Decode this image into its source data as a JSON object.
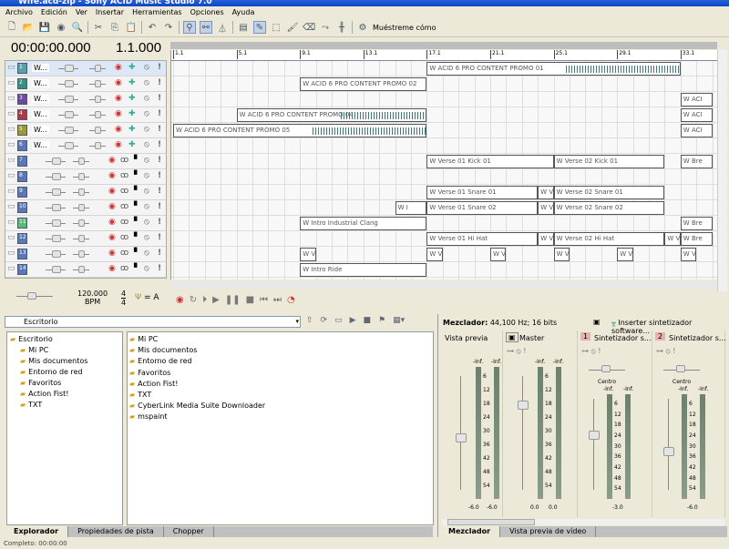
{
  "window": {
    "title": "Wife.acd-zip - Sony ACID Music Studio 7.0"
  },
  "menu": [
    "Archivo",
    "Edición",
    "Ver",
    "Insertar",
    "Herramientas",
    "Opciones",
    "Ayuda"
  ],
  "toolbar": {
    "show_me_label": "Muéstreme cómo",
    "icons": [
      "new-icon",
      "open-icon",
      "save-icon",
      "render-icon",
      "properties-icon",
      "cut-icon",
      "copy-icon",
      "paste-icon",
      "undo-icon",
      "redo-icon",
      "snap-icon",
      "auto-ripple-icon",
      "metronome-icon",
      "properties-window-icon",
      "draw-tool-icon",
      "selection-tool-icon",
      "paint-tool-icon",
      "erase-tool-icon",
      "envelope-tool-icon",
      "split-icon"
    ]
  },
  "transport": {
    "time": "00:00:00.000",
    "measure": "1.1.000",
    "tempo": "120.000",
    "tempo_unit": "BPM",
    "time_sig_top": "4",
    "time_sig_bottom": "4",
    "key": "= A",
    "buttons": [
      "record",
      "loop",
      "play-from-start",
      "play",
      "pause",
      "stop",
      "go-to-start",
      "go-to-end",
      "metronome"
    ]
  },
  "ruler": [
    "1.1",
    "5.1",
    "9.1",
    "13.1",
    "17.1",
    "21.1",
    "25.1",
    "29.1",
    "33.1"
  ],
  "tracks": [
    {
      "n": "1",
      "name": "W...",
      "color": "#5aa0a8",
      "selected": true,
      "type": "audio"
    },
    {
      "n": "2",
      "name": "W...",
      "color": "#3a9080",
      "type": "audio"
    },
    {
      "n": "3",
      "name": "W...",
      "color": "#6a4a9a",
      "type": "audio"
    },
    {
      "n": "4",
      "name": "W...",
      "color": "#a83a4a",
      "type": "audio"
    },
    {
      "n": "5",
      "name": "W...",
      "color": "#9a9a3a",
      "type": "audio"
    },
    {
      "n": "6",
      "name": "W...",
      "color": "#5a78b8",
      "type": "audio"
    },
    {
      "n": "7",
      "color": "#5a78b8",
      "type": "midi"
    },
    {
      "n": "8",
      "color": "#5a78b8",
      "type": "midi"
    },
    {
      "n": "9",
      "color": "#5a78b8",
      "type": "midi"
    },
    {
      "n": "10",
      "color": "#5a78b8",
      "type": "midi"
    },
    {
      "n": "11",
      "color": "#5ab87a",
      "type": "midi"
    },
    {
      "n": "12",
      "color": "#5a78b8",
      "type": "midi"
    },
    {
      "n": "13",
      "color": "#5a78b8",
      "type": "midi"
    },
    {
      "n": "14",
      "color": "#5a78b8",
      "type": "midi"
    }
  ],
  "clips": [
    {
      "track": 1,
      "start": 17,
      "end": 33,
      "label": "W ACID 6 PRO CONTENT PROMO 01",
      "wave": true
    },
    {
      "track": 2,
      "start": 9,
      "end": 17,
      "label": "W ACID 6 PRO CONTENT PROMO 02"
    },
    {
      "track": 3,
      "start": 33,
      "end": 35,
      "label": "W ACI"
    },
    {
      "track": 4,
      "start": 5,
      "end": 17,
      "label": "W ACID 6 PRO CONTENT PROMO 04",
      "wave": true
    },
    {
      "track": 4,
      "start": 33,
      "end": 35,
      "label": "W ACI"
    },
    {
      "track": 5,
      "start": 1,
      "end": 17,
      "label": "W ACID 6 PRO CONTENT PROMO 05",
      "wave": true
    },
    {
      "track": 5,
      "start": 33,
      "end": 35,
      "label": "W ACI"
    },
    {
      "track": 7,
      "start": 17,
      "end": 25,
      "label": "W Verse 01 Kick 01"
    },
    {
      "track": 7,
      "start": 25,
      "end": 32,
      "label": "W Verse 02 Kick 01"
    },
    {
      "track": 7,
      "start": 33,
      "end": 35,
      "label": "W Bre"
    },
    {
      "track": 9,
      "start": 17,
      "end": 24,
      "label": "W Verse 01 Snare 01"
    },
    {
      "track": 9,
      "start": 24,
      "end": 25,
      "label": "W V"
    },
    {
      "track": 9,
      "start": 25,
      "end": 32,
      "label": "W Verse 02 Snare 01"
    },
    {
      "track": 10,
      "start": 15,
      "end": 17,
      "label": "W I"
    },
    {
      "track": 10,
      "start": 17,
      "end": 24,
      "label": "W Verse 01 Snare 02"
    },
    {
      "track": 10,
      "start": 24,
      "end": 25,
      "label": "W V"
    },
    {
      "track": 10,
      "start": 25,
      "end": 32,
      "label": "W Verse 02 Snare 02"
    },
    {
      "track": 11,
      "start": 9,
      "end": 17,
      "label": "W Intro Industrial Clang"
    },
    {
      "track": 11,
      "start": 33,
      "end": 35,
      "label": "W Bre"
    },
    {
      "track": 12,
      "start": 17,
      "end": 24,
      "label": "W Verse 01 Hi Hat"
    },
    {
      "track": 12,
      "start": 24,
      "end": 25,
      "label": "W V"
    },
    {
      "track": 12,
      "start": 25,
      "end": 32,
      "label": "W Verse 02 Hi Hat"
    },
    {
      "track": 12,
      "start": 32,
      "end": 33,
      "label": "W V"
    },
    {
      "track": 12,
      "start": 33,
      "end": 35,
      "label": "W Bre"
    },
    {
      "track": 13,
      "start": 9,
      "end": 10,
      "label": "W V"
    },
    {
      "track": 13,
      "start": 17,
      "end": 18,
      "label": "W V"
    },
    {
      "track": 13,
      "start": 21,
      "end": 22,
      "label": "W V"
    },
    {
      "track": 13,
      "start": 25,
      "end": 26,
      "label": "W V"
    },
    {
      "track": 13,
      "start": 29,
      "end": 30,
      "label": "W V"
    },
    {
      "track": 13,
      "start": 33,
      "end": 34,
      "label": "W V"
    },
    {
      "track": 14,
      "start": 9,
      "end": 17,
      "label": "W Intro Ride"
    }
  ],
  "explorer": {
    "path": "Escritorio",
    "tree": [
      "Escritorio",
      "Mi PC",
      "Mis documentos",
      "Entorno de red",
      "Favoritos",
      "Action Fist!",
      "TXT"
    ],
    "files": [
      "Mi PC",
      "Mis documentos",
      "Entorno de red",
      "Favoritos",
      "Action Fist!",
      "TXT",
      "CyberLink Media Suite Downloader",
      "mspaint"
    ],
    "tabs": [
      "Explorador",
      "Propiedades de pista",
      "Chopper"
    ]
  },
  "mixer": {
    "label": "Mezclador:",
    "format": "44,100 Hz; 16 bits",
    "insert_label": "Inserter sintetizador software...",
    "strips": [
      {
        "name": "Vista previa",
        "top": "-Inf.",
        "bottom": [
          "-6.0",
          "-6.0"
        ],
        "fader_db": -6
      },
      {
        "name": "Master",
        "top": "-Inf.",
        "bottom": [
          "0.0",
          "0.0"
        ],
        "fader_db": 0
      },
      {
        "name": "Sintetizador s...",
        "num": "1",
        "pan": "Centro",
        "top": "-Inf.",
        "bottom": [
          "-3.0"
        ],
        "fader_db": -3
      },
      {
        "name": "Sintetizador s...",
        "num": "2",
        "pan": "Centro",
        "top": "-Inf.",
        "bottom": [
          "-6.0"
        ],
        "fader_db": -6
      }
    ],
    "scale": [
      "6",
      "12",
      "18",
      "24",
      "30",
      "36",
      "42",
      "48",
      "54"
    ],
    "tabs": [
      "Mezclador",
      "Vista previa de vídeo"
    ]
  },
  "status": "Completo: 00:00:00"
}
